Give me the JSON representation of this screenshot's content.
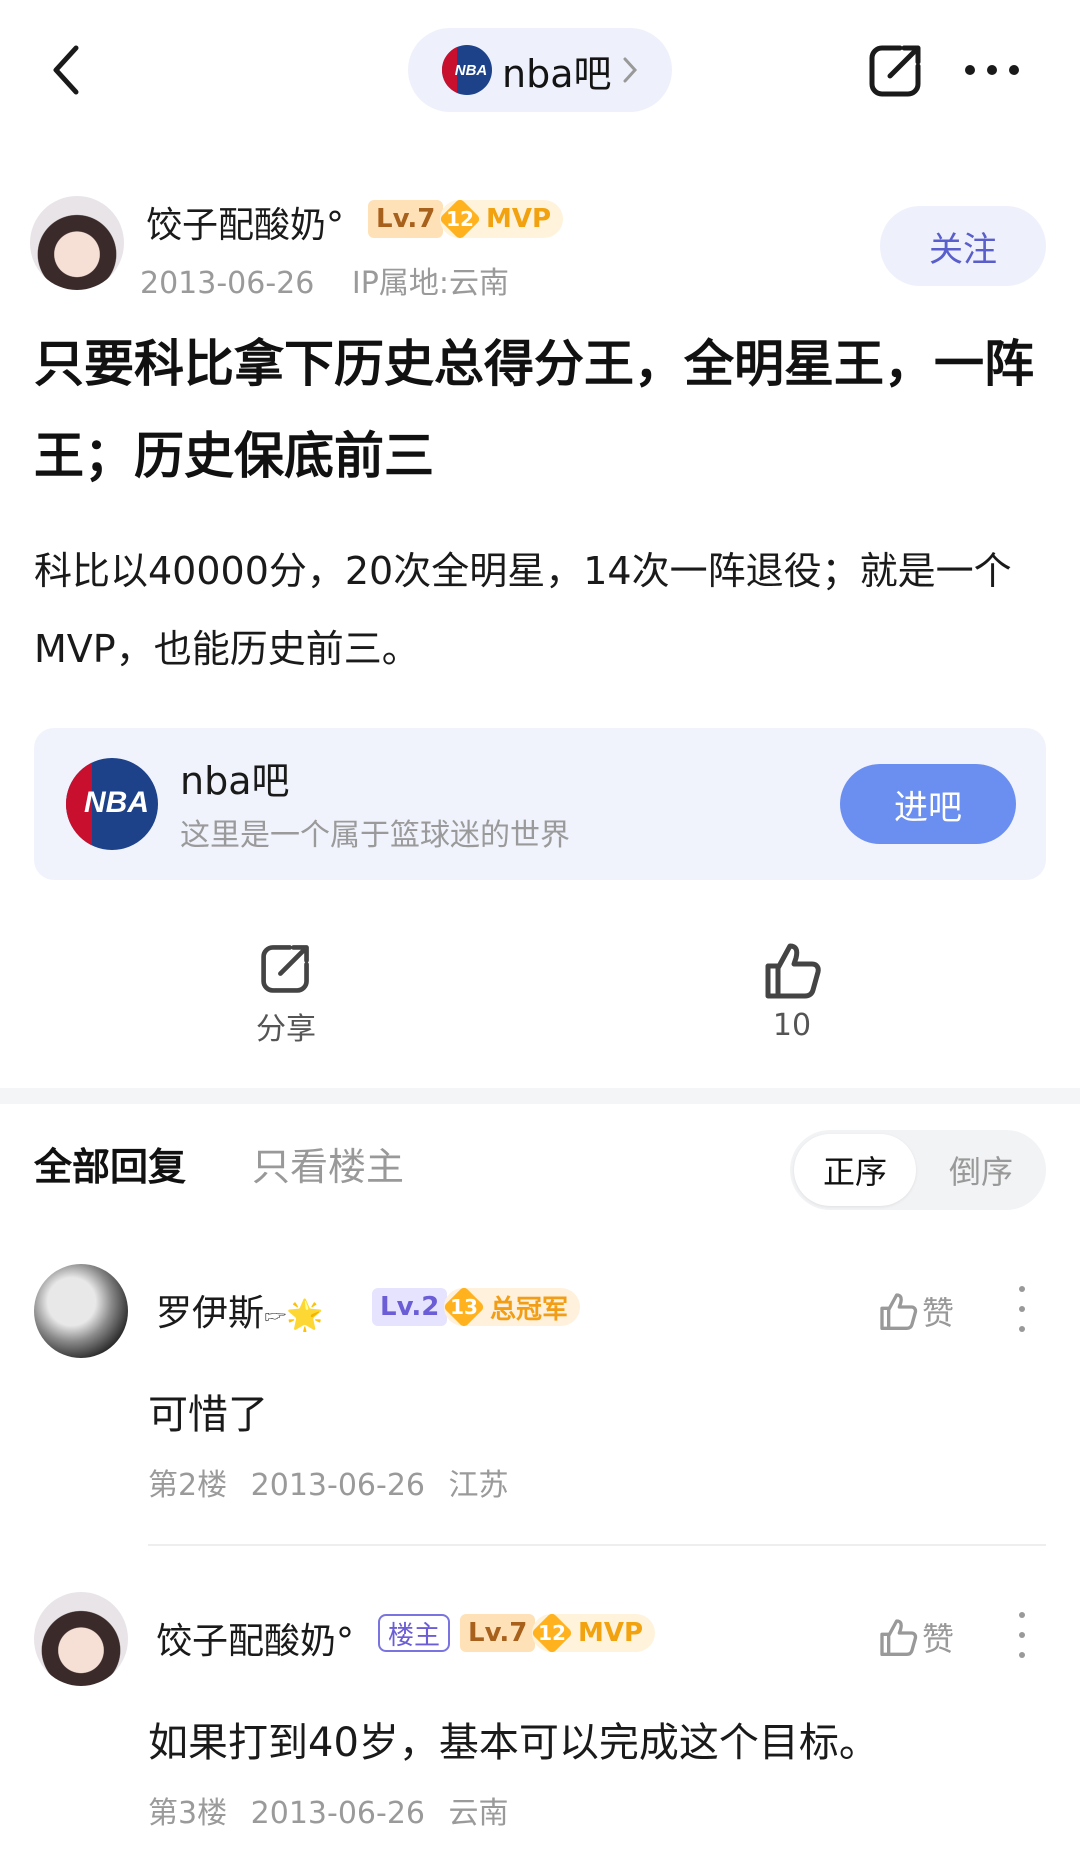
{
  "topbar": {
    "forum_name": "nba吧",
    "logo_text": "NBA"
  },
  "post": {
    "author": {
      "name": "饺子配酸奶°",
      "level": "Lv.7",
      "honor_num": "12",
      "honor": "MVP",
      "date": "2013-06-26",
      "ip": "IP属地:云南"
    },
    "follow_label": "关注",
    "title": "只要科比拿下历史总得分王，全明星王，一阵王；历史保底前三",
    "body": "科比以40000分，20次全明星，14次一阵退役；就是一个MVP，也能历史前三。"
  },
  "forum_card": {
    "name": "nba吧",
    "desc": "这里是一个属于篮球迷的世界",
    "enter_label": "进吧",
    "logo_text": "NBA"
  },
  "actions": {
    "share_label": "分享",
    "like_count": "10"
  },
  "replies_header": {
    "tab_all": "全部回复",
    "tab_op": "只看楼主",
    "order_asc": "正序",
    "order_desc": "倒序"
  },
  "replies": [
    {
      "name": "罗伊斯",
      "name_emoji": "🖙🌟",
      "level": "Lv.2",
      "honor_num": "13",
      "honor": "总冠军",
      "text": "可惜了",
      "floor": "第2楼",
      "date": "2013-06-26",
      "location": "江苏",
      "like_label": "赞"
    },
    {
      "name": "饺子配酸奶°",
      "op_tag": "楼主",
      "level": "Lv.7",
      "honor_num": "12",
      "honor": "MVP",
      "text": "如果打到40岁，基本可以完成这个目标。",
      "floor": "第3楼",
      "date": "2013-06-26",
      "location": "云南",
      "like_label": "赞"
    }
  ],
  "colors": {
    "accent_blue": "#6b8ff0",
    "nba_blue": "#1d428a",
    "nba_red": "#c8102e",
    "honor_gold": "#ffb21e"
  }
}
